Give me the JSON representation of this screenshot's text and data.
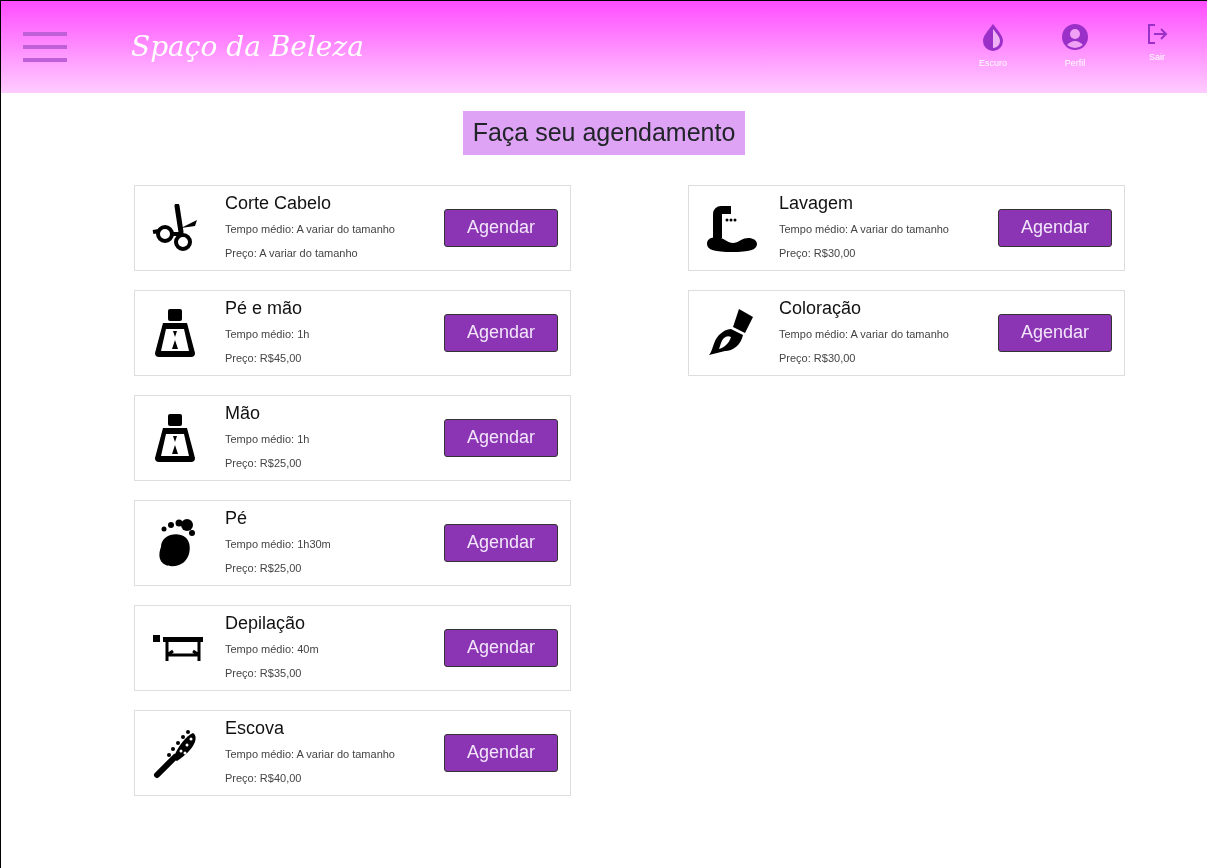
{
  "header": {
    "brand": "Spaço da Beleza",
    "actions": [
      {
        "kind": "theme",
        "label": "Escuro"
      },
      {
        "kind": "profile",
        "label": "Perfil"
      },
      {
        "kind": "logout",
        "label": "Sair"
      }
    ]
  },
  "heading": "Faça seu agendamento",
  "columns": [
    [
      {
        "kind": "scissors",
        "name": "Corte Cabelo",
        "time": "Tempo médio: A variar do tamanho",
        "price": "Preço: A variar do tamanho",
        "button": "Agendar"
      },
      {
        "kind": "polish",
        "name": "Pé e mão",
        "time": "Tempo médio: 1h",
        "price": "Preço: R$45,00",
        "button": "Agendar"
      },
      {
        "kind": "polish",
        "name": "Mão",
        "time": "Tempo médio: 1h",
        "price": "Preço: R$25,00",
        "button": "Agendar"
      },
      {
        "kind": "foot",
        "name": "Pé",
        "time": "Tempo médio: 1h30m",
        "price": "Preço: R$25,00",
        "button": "Agendar"
      },
      {
        "kind": "table",
        "name": "Depilação",
        "time": "Tempo médio: 40m",
        "price": "Preço: R$35,00",
        "button": "Agendar"
      },
      {
        "kind": "brush",
        "name": "Escova",
        "time": "Tempo médio: A variar do tamanho",
        "price": "Preço: R$40,00",
        "button": "Agendar"
      }
    ],
    [
      {
        "kind": "basin",
        "name": "Lavagem",
        "time": "Tempo médio: A variar do tamanho",
        "price": "Preço: R$30,00",
        "button": "Agendar"
      },
      {
        "kind": "paint",
        "name": "Coloração",
        "time": "Tempo médio: A variar do tamanho",
        "price": "Preço: R$30,00",
        "button": "Agendar"
      }
    ]
  ]
}
